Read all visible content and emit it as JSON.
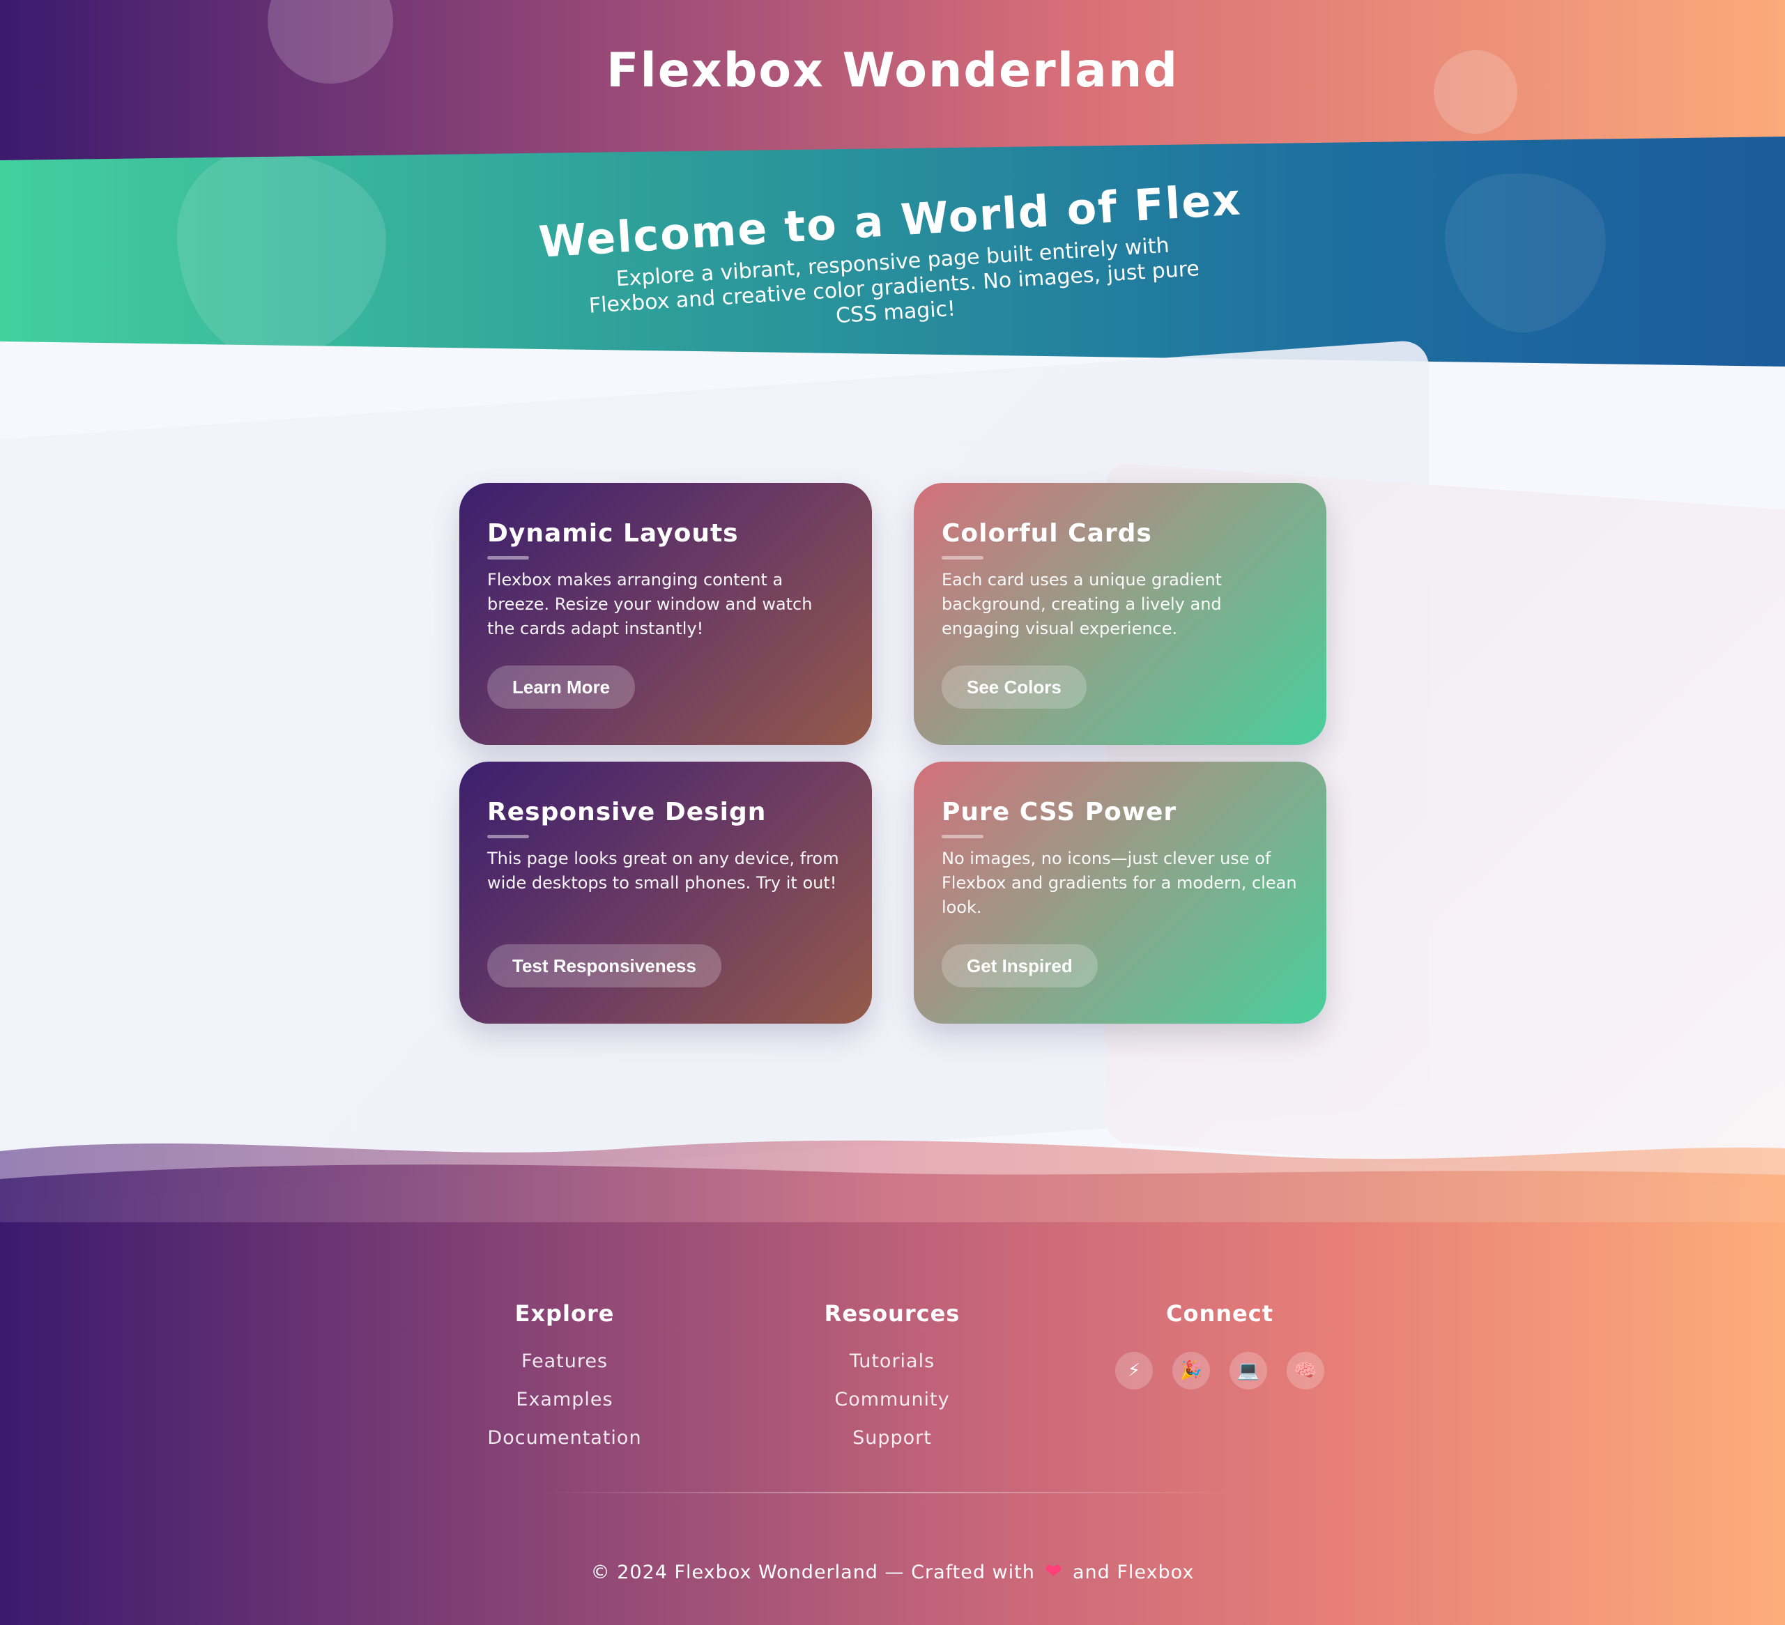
{
  "header": {
    "title": "Flexbox Wonderland"
  },
  "hero": {
    "title": "Welcome to a World of Flex",
    "subtitle": "Explore a vibrant, responsive page built entirely with Flexbox and creative color gradients. No images, just pure CSS magic!"
  },
  "cards": [
    {
      "title": "Dynamic Layouts",
      "text": "Flexbox makes arranging content a breeze. Resize your window and watch the cards adapt instantly!",
      "button": "Learn More"
    },
    {
      "title": "Colorful Cards",
      "text": "Each card uses a unique gradient background, creating a lively and engaging visual experience.",
      "button": "See Colors"
    },
    {
      "title": "Responsive Design",
      "text": "This page looks great on any device, from wide desktops to small phones. Try it out!",
      "button": "Test Responsiveness"
    },
    {
      "title": "Pure CSS Power",
      "text": "No images, no icons—just clever use of Flexbox and gradients for a modern, clean look.",
      "button": "Get Inspired"
    }
  ],
  "footer": {
    "explore": {
      "heading": "Explore",
      "links": [
        "Features",
        "Examples",
        "Documentation"
      ]
    },
    "resources": {
      "heading": "Resources",
      "links": [
        "Tutorials",
        "Community",
        "Support"
      ]
    },
    "connect": {
      "heading": "Connect",
      "icons": [
        "⚡",
        "🎉",
        "💻",
        "🧠"
      ],
      "icon_names": [
        "lightning-icon",
        "party-popper-icon",
        "laptop-icon",
        "brain-icon"
      ]
    },
    "copyright_prefix": "© 2024 Flexbox Wonderland — Crafted with",
    "heart": "❤",
    "copyright_suffix": "and Flexbox"
  },
  "colors": {
    "header_gradient": [
      "#3b1a6e",
      "#d86e78",
      "#fbaa7a"
    ],
    "hero_gradient": [
      "#43cf9e",
      "#1c5b9c"
    ],
    "card_purple": [
      "#3b1f6e",
      "#945a4a"
    ],
    "card_green": [
      "#d3707a",
      "#48cf9b"
    ]
  }
}
